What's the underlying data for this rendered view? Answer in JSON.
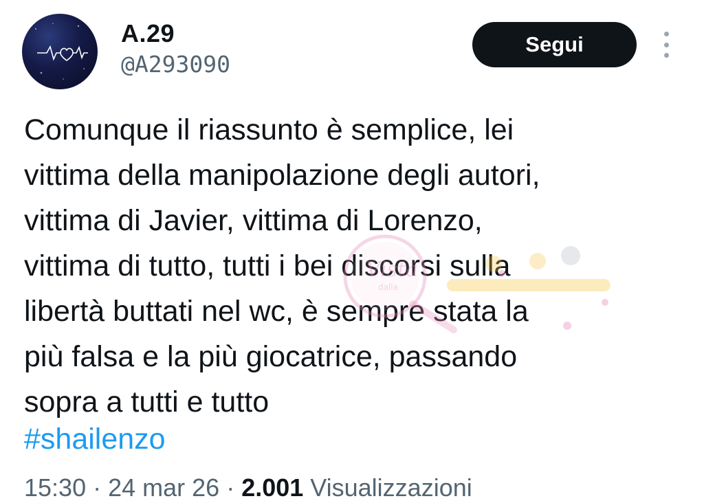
{
  "user": {
    "display_name": "A.29",
    "handle": "@A293090",
    "avatar_icon": "heartbeat-avatar-icon"
  },
  "actions": {
    "follow_label": "Segui",
    "more_icon": "more-vertical-icon"
  },
  "tweet": {
    "lines": [
      "Comunque il riassunto è semplice, lei",
      "vittima della manipolazione degli autori,",
      "vittima di Javier, vittima di Lorenzo,",
      "vittima di tutto, tutti i bei discorsi sulla",
      "libertà buttati nel wc, è sempre stata la",
      "più falsa e la più giocatrice, passando",
      "sopra a tutti e tutto"
    ],
    "hashtag": "#shailenzo"
  },
  "meta": {
    "time": "15:30",
    "separator_1": " · ",
    "date": "24 mar 26",
    "separator_2": " · ",
    "views_count": "2.001",
    "views_label": " Visualizzazioni"
  },
  "colors": {
    "text": "#0f1419",
    "secondary": "#536471",
    "link": "#1d9bf0",
    "button_bg": "#0f1419",
    "button_text": "#ffffff"
  }
}
